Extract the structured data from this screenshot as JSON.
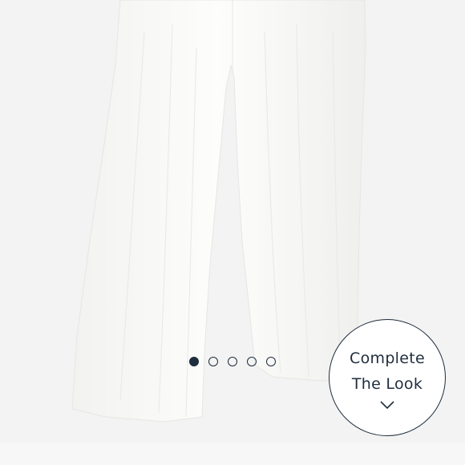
{
  "product": {
    "image_description": "white gauze wide-leg pants",
    "colors": {
      "background": "#f3f3f3",
      "garment": "#fbfbfa",
      "accent": "#1f2d3d"
    }
  },
  "carousel": {
    "total": 5,
    "active_index": 0,
    "dots": [
      "dot-1",
      "dot-2",
      "dot-3",
      "dot-4",
      "dot-5"
    ]
  },
  "complete_look": {
    "line1": "Complete",
    "line2": "The Look",
    "icon": "chevron-down-icon"
  }
}
